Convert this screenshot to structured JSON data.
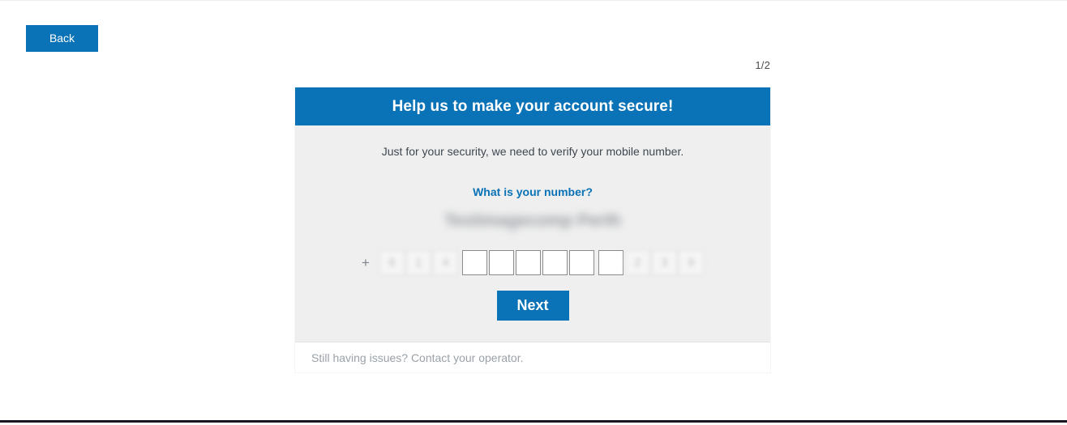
{
  "page": {
    "step_indicator": "1/2"
  },
  "nav": {
    "back_label": "Back"
  },
  "card": {
    "header_title": "Help us to make your account secure!",
    "subtitle": "Just for your security, we need to verify your mobile number.",
    "help_link": "What is your number?",
    "operator_name": "Testimagecomp Perth",
    "phone_entry": {
      "prefix_symbol": "+",
      "country_code_digits": [
        "6",
        "1",
        "4"
      ],
      "input_digits": [
        "",
        "",
        "",
        "",
        "",
        ""
      ],
      "suffix_digits": [
        "2",
        "3",
        "9"
      ],
      "input_placeholder": ""
    },
    "next_label": "Next",
    "footer_text": "Still having issues? Contact your operator."
  },
  "colors": {
    "brand_blue": "#0a72b6",
    "card_body": "#efefef",
    "footer_text": "#9aa1a9",
    "page_bottom_rule": "#1b1320"
  }
}
